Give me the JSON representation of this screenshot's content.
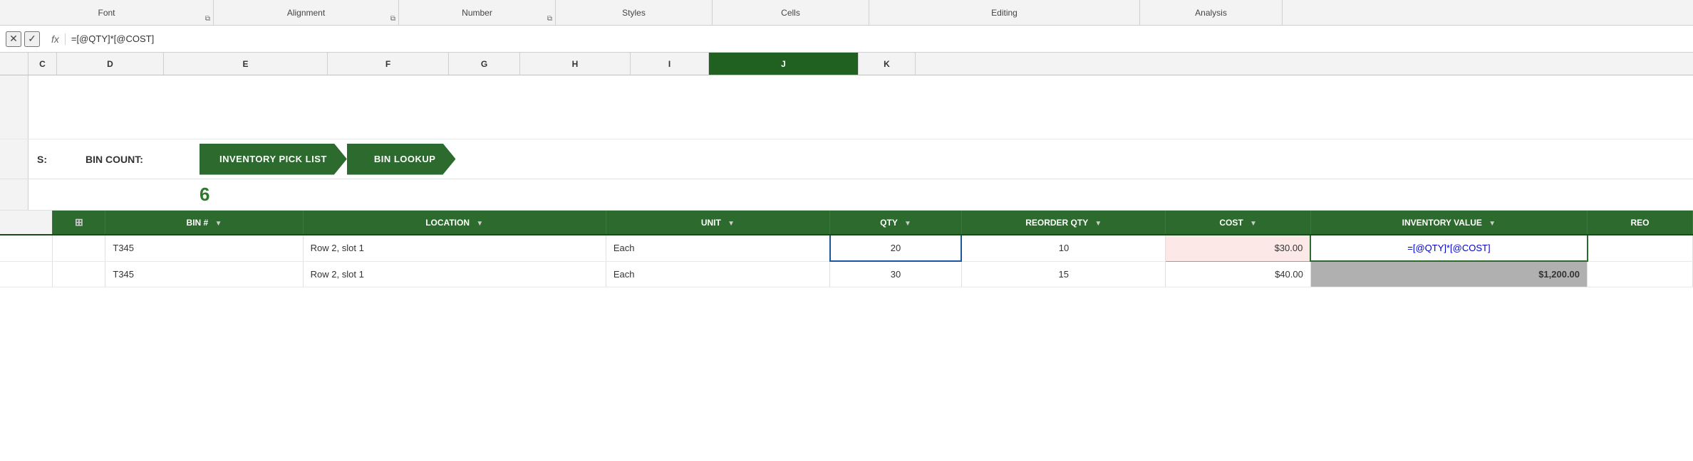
{
  "ribbon": {
    "sections": [
      {
        "label": "Font",
        "hasExpand": true
      },
      {
        "label": "Alignment",
        "hasExpand": true
      },
      {
        "label": "Number",
        "hasExpand": true
      },
      {
        "label": "Styles",
        "hasExpand": false
      },
      {
        "label": "Cells",
        "hasExpand": false
      },
      {
        "label": "Editing",
        "hasExpand": false
      },
      {
        "label": "Analysis",
        "hasExpand": false
      }
    ]
  },
  "formula_bar": {
    "cancel_label": "✕",
    "confirm_label": "✓",
    "fx_label": "fx",
    "formula_value": "=[@QTY]*[@COST]"
  },
  "col_headers": [
    {
      "label": "C",
      "active": false
    },
    {
      "label": "D",
      "active": false
    },
    {
      "label": "E",
      "active": false
    },
    {
      "label": "F",
      "active": false
    },
    {
      "label": "G",
      "active": false
    },
    {
      "label": "H",
      "active": false
    },
    {
      "label": "I",
      "active": false
    },
    {
      "label": "J",
      "active": true
    },
    {
      "label": "K",
      "active": false
    }
  ],
  "content": {
    "partial_label": "S:",
    "bin_count_label": "BIN COUNT:",
    "bin_count_value": "6",
    "nav_buttons": [
      {
        "label": "INVENTORY PICK LIST",
        "type": "arrow"
      },
      {
        "label": "BIN LOOKUP",
        "type": "arrow"
      }
    ]
  },
  "table": {
    "headers": [
      {
        "label": "",
        "key": "drag"
      },
      {
        "label": "BIN #",
        "key": "bin"
      },
      {
        "label": "LOCATION",
        "key": "location"
      },
      {
        "label": "UNIT",
        "key": "unit"
      },
      {
        "label": "QTY",
        "key": "qty"
      },
      {
        "label": "REORDER QTY",
        "key": "reorder_qty"
      },
      {
        "label": "COST",
        "key": "cost"
      },
      {
        "label": "INVENTORY VALUE",
        "key": "inv_value"
      },
      {
        "label": "REO",
        "key": "reo"
      }
    ],
    "rows": [
      {
        "bin": "T345",
        "location": "Row 2, slot 1",
        "unit": "Each",
        "qty": "20",
        "reorder_qty": "10",
        "cost": "$30.00",
        "inv_value": "=[@QTY]*[@COST]",
        "reo": ""
      },
      {
        "bin": "T345",
        "location": "Row 2, slot 1",
        "unit": "Each",
        "qty": "30",
        "reorder_qty": "15",
        "cost": "$40.00",
        "inv_value": "$1,200.00",
        "reo": ""
      }
    ]
  }
}
